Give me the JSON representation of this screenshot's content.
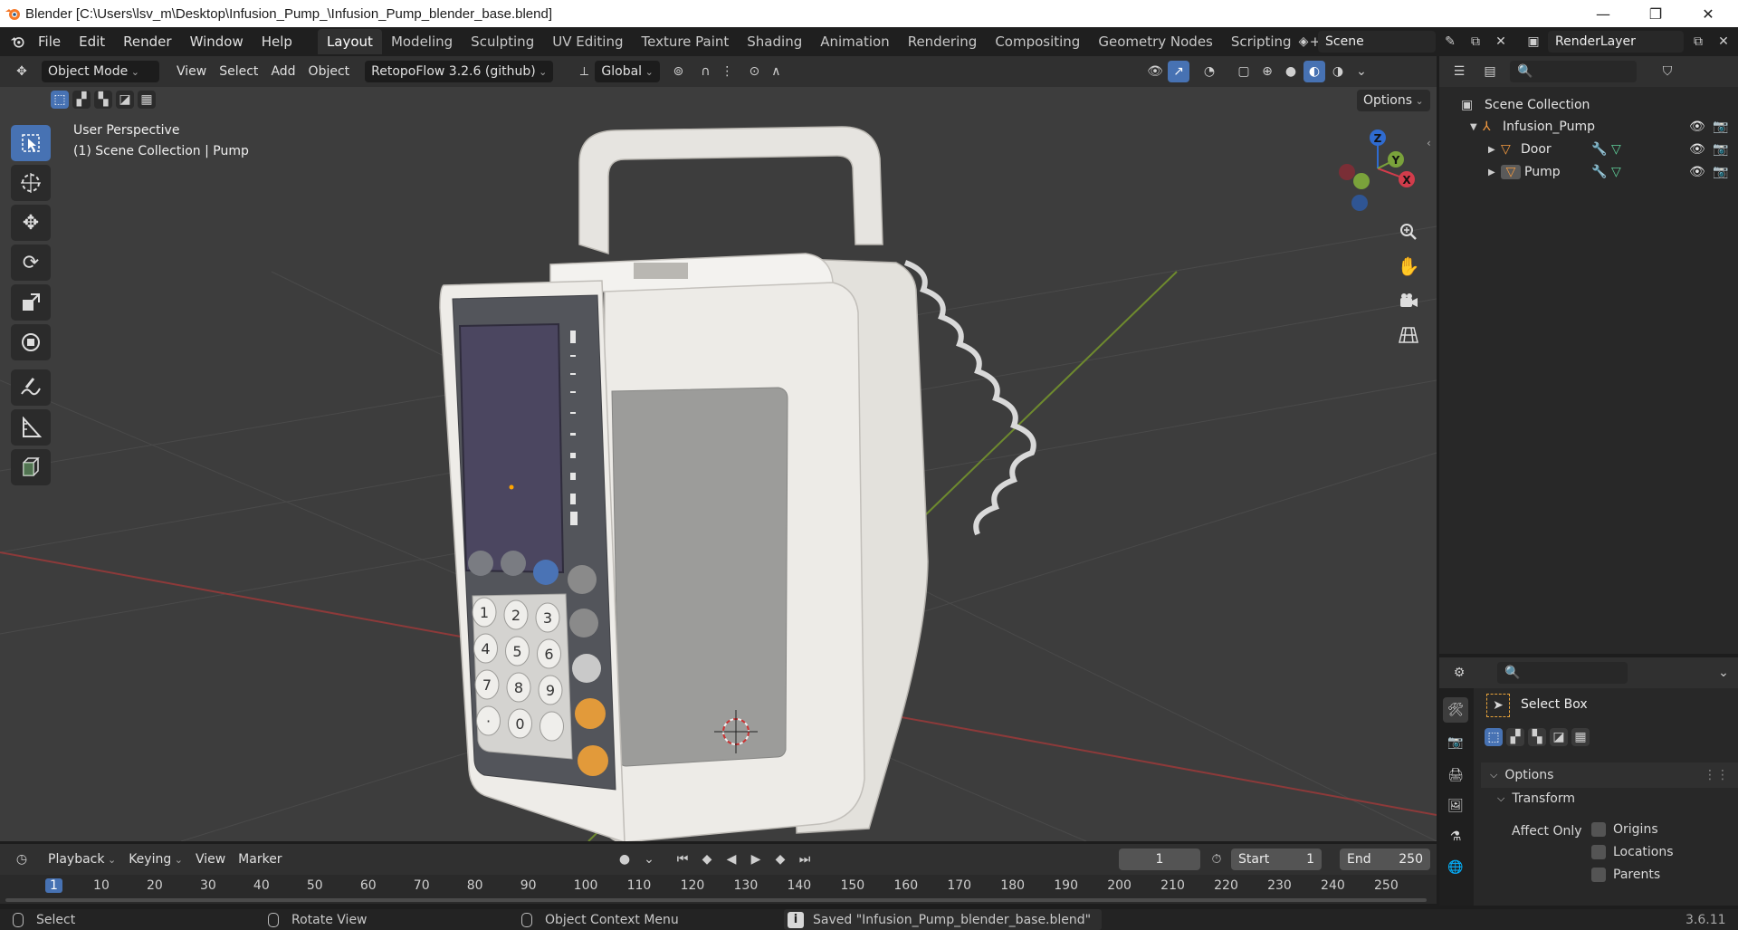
{
  "window": {
    "title": "Blender [C:\\Users\\lsv_m\\Desktop\\Infusion_Pump_\\Infusion_Pump_blender_base.blend]",
    "minimize": "—",
    "restore": "❐",
    "close": "✕"
  },
  "topbar": {
    "menus": [
      "File",
      "Edit",
      "Render",
      "Window",
      "Help"
    ],
    "workspaces": [
      "Layout",
      "Modeling",
      "Sculpting",
      "UV Editing",
      "Texture Paint",
      "Shading",
      "Animation",
      "Rendering",
      "Compositing",
      "Geometry Nodes",
      "Scripting"
    ],
    "active_workspace": "Layout",
    "add_workspace": "+",
    "scene": "Scene",
    "view_layer": "RenderLayer"
  },
  "viewport_header": {
    "mode": "Object Mode",
    "menus": [
      "View",
      "Select",
      "Add",
      "Object"
    ],
    "addon": "RetopoFlow 3.2.6 (github)",
    "orientation": "Global",
    "options": "Options"
  },
  "viewport": {
    "perspective": "User Perspective",
    "collection": "(1) Scene Collection | Pump",
    "gizmo": {
      "x": "X",
      "y": "Y",
      "z": "Z"
    }
  },
  "outliner": {
    "root": "Scene Collection",
    "collection": "Infusion_Pump",
    "objects": [
      "Door",
      "Pump"
    ]
  },
  "properties": {
    "tool_name": "Select Box",
    "options_panel": "Options",
    "transform_panel": "Transform",
    "affect_only": "Affect Only",
    "checkboxes": [
      "Origins",
      "Locations",
      "Parents"
    ]
  },
  "timeline": {
    "menus": [
      "Playback",
      "Keying",
      "View",
      "Marker"
    ],
    "current_frame": "1",
    "start_label": "Start",
    "start": "1",
    "end_label": "End",
    "end": "250",
    "ruler": [
      "1",
      "10",
      "20",
      "30",
      "40",
      "50",
      "60",
      "70",
      "80",
      "90",
      "100",
      "110",
      "120",
      "130",
      "140",
      "150",
      "160",
      "170",
      "180",
      "190",
      "200",
      "210",
      "220",
      "230",
      "240",
      "250"
    ]
  },
  "statusbar": {
    "select": "Select",
    "rotate": "Rotate View",
    "context": "Object Context Menu",
    "message": "Saved \"Infusion_Pump_blender_base.blend\"",
    "version": "3.6.11"
  },
  "pump_screen": {
    "keypad": [
      "1",
      "2",
      "3",
      "4",
      "5",
      "6",
      "7",
      "8",
      "9",
      "·",
      "0",
      ""
    ]
  }
}
